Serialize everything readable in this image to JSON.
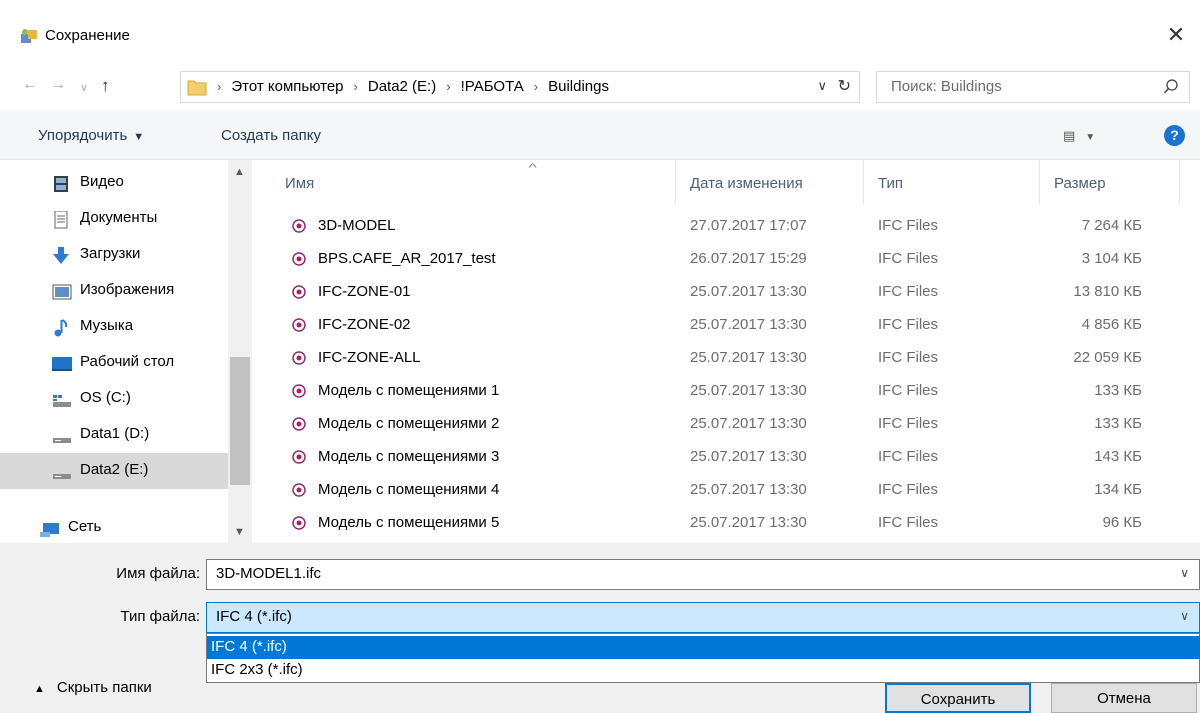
{
  "window": {
    "title": "Сохранение"
  },
  "address": {
    "crumbs": [
      "Этот компьютер",
      "Data2 (E:)",
      "!РАБОТА",
      "Buildings"
    ]
  },
  "search": {
    "placeholder": "Поиск: Buildings"
  },
  "toolbar": {
    "organize": "Упорядочить",
    "new_folder": "Создать папку",
    "help": "?"
  },
  "nav": {
    "items": [
      {
        "label": "Видео",
        "icon": "video-icon"
      },
      {
        "label": "Документы",
        "icon": "documents-icon"
      },
      {
        "label": "Загрузки",
        "icon": "downloads-icon"
      },
      {
        "label": "Изображения",
        "icon": "pictures-icon"
      },
      {
        "label": "Музыка",
        "icon": "music-icon"
      },
      {
        "label": "Рабочий стол",
        "icon": "desktop-icon"
      },
      {
        "label": "OS (C:)",
        "icon": "os-drive-icon"
      },
      {
        "label": "Data1 (D:)",
        "icon": "drive-icon"
      },
      {
        "label": "Data2 (E:)",
        "icon": "drive-icon",
        "selected": true
      },
      {
        "label": "Сеть",
        "icon": "network-icon"
      }
    ]
  },
  "columns": {
    "name": "Имя",
    "date": "Дата изменения",
    "type": "Тип",
    "size": "Размер"
  },
  "files": [
    {
      "name": "3D-MODEL",
      "date": "27.07.2017 17:07",
      "type": "IFC Files",
      "size": "7 264 КБ"
    },
    {
      "name": "BPS.CAFE_AR_2017_test",
      "date": "26.07.2017 15:29",
      "type": "IFC Files",
      "size": "3 104 КБ"
    },
    {
      "name": "IFC-ZONE-01",
      "date": "25.07.2017 13:30",
      "type": "IFC Files",
      "size": "13 810 КБ"
    },
    {
      "name": "IFC-ZONE-02",
      "date": "25.07.2017 13:30",
      "type": "IFC Files",
      "size": "4 856 КБ"
    },
    {
      "name": "IFC-ZONE-ALL",
      "date": "25.07.2017 13:30",
      "type": "IFC Files",
      "size": "22 059 КБ"
    },
    {
      "name": "Модель с помещениями 1",
      "date": "25.07.2017 13:30",
      "type": "IFC Files",
      "size": "133 КБ"
    },
    {
      "name": "Модель с помещениями 2",
      "date": "25.07.2017 13:30",
      "type": "IFC Files",
      "size": "133 КБ"
    },
    {
      "name": "Модель с помещениями 3",
      "date": "25.07.2017 13:30",
      "type": "IFC Files",
      "size": "143 КБ"
    },
    {
      "name": "Модель с помещениями 4",
      "date": "25.07.2017 13:30",
      "type": "IFC Files",
      "size": "134 КБ"
    },
    {
      "name": "Модель с помещениями 5",
      "date": "25.07.2017 13:30",
      "type": "IFC Files",
      "size": "96 КБ"
    }
  ],
  "form": {
    "filename_label": "Имя файла:",
    "filename_value": "3D-MODEL1.ifc",
    "filetype_label": "Тип файла:",
    "filetype_value": "IFC 4 (*.ifc)",
    "filetype_options": [
      "IFC 4 (*.ifc)",
      "IFC 2x3 (*.ifc)"
    ]
  },
  "footer": {
    "hide_folders": "Скрыть папки",
    "save": "Сохранить",
    "cancel": "Отмена"
  },
  "colors": {
    "accent": "#0078d7",
    "selection": "#d9d9d9",
    "help": "#1a73d2"
  }
}
